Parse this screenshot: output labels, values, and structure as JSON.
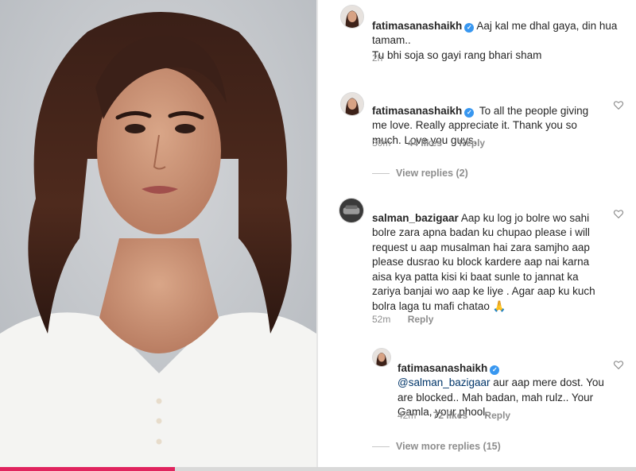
{
  "post": {
    "caption": {
      "username": "fatimasanashaikh",
      "text": "Aaj kal me dhal gaya, din hua tamam..\nTu bhi soja so gayi rang bhari sham",
      "time": "2h"
    }
  },
  "comments": [
    {
      "username": "fatimasanashaikh",
      "verified": true,
      "text": "To all the people giving me love. Really appreciate it. Thank you so much. Love you guys.",
      "time": "30m",
      "likes": "44 likes",
      "reply_label": "Reply",
      "view_replies": "View replies (2)"
    },
    {
      "username": "salman_bazigaar",
      "verified": false,
      "text": "Aap ku log jo bolre wo sahi bolre zara apna badan ku chupao please i will request u aap musalman hai zara samjho aap please dusrao ku block kardere aap nai karna aisa kya patta kisi ki baat sunle to jannat ka zariya banjai wo aap ke liye . Agar aap ku kuch bolra laga tu mafi chatao 🙏",
      "time": "52m",
      "reply_label": "Reply"
    }
  ],
  "reply": {
    "username": "fatimasanashaikh",
    "verified": true,
    "mention": "@salman_bazigaar",
    "text": " aur aap mere dost.  You are blocked.. Mah badan, mah rulz.. Your Gamla, your phool.",
    "time": "42m",
    "likes": "72 likes",
    "reply_label": "Reply",
    "view_more": "View more replies (15)"
  },
  "icons": {
    "verified": "verified-check-icon",
    "heart": "heart-outline-icon"
  },
  "colors": {
    "verified": "#3897f0",
    "meta_text": "#8e8e8e",
    "progress": "#e0245e"
  },
  "video_progress": 0.275
}
